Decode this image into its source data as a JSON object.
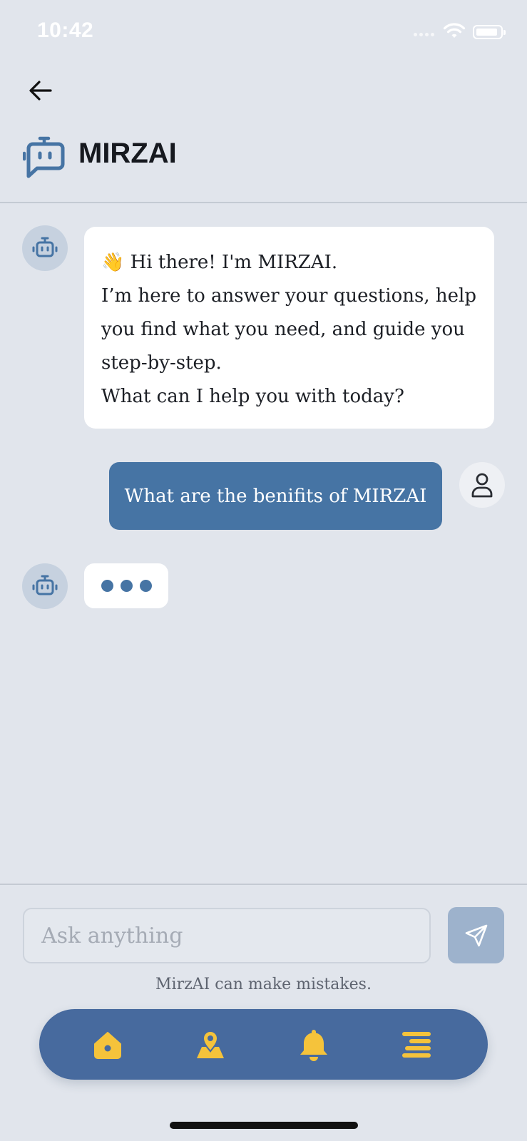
{
  "status_bar": {
    "time": "10:42"
  },
  "header": {
    "title": "MIRZAI",
    "back_icon": "arrow-left-icon",
    "logo_icon": "robot-chat-icon"
  },
  "messages": [
    {
      "sender": "bot",
      "emoji": "👋",
      "lines": [
        "Hi there! I'm MIRZAI.",
        "I’m here to answer your questions, help",
        "you find what you need, and guide you",
        "step-by-step.",
        "What can I help you with today?"
      ]
    },
    {
      "sender": "user",
      "text": "What are the benifits of MIRZAI"
    },
    {
      "sender": "bot",
      "typing": true
    }
  ],
  "composer": {
    "placeholder": "Ask anything",
    "value": "",
    "send_icon": "send-icon"
  },
  "disclaimer": "MirzAI can make mistakes.",
  "bottom_nav": {
    "items": [
      {
        "icon": "home-icon"
      },
      {
        "icon": "map-pin-icon"
      },
      {
        "icon": "bell-icon"
      },
      {
        "icon": "menu-icon"
      }
    ]
  },
  "colors": {
    "background": "#e1e5ec",
    "accent": "#4674a4",
    "nav": "#476a9e",
    "nav_icons": "#f5c33b",
    "send_button": "#9db2cc"
  }
}
